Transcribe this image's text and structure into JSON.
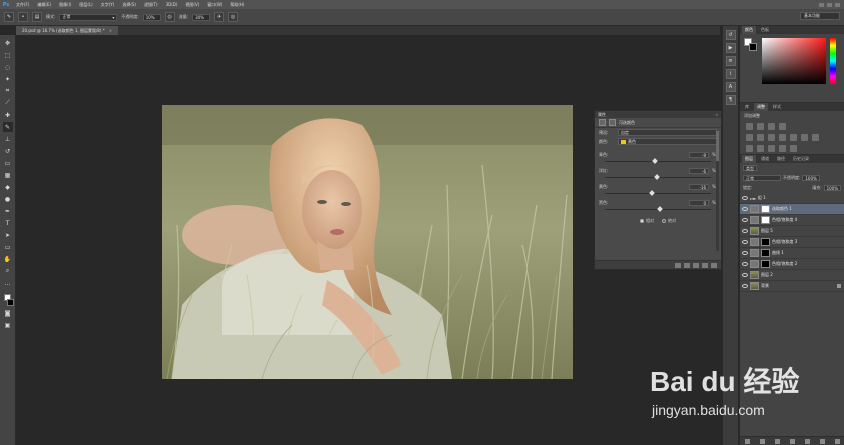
{
  "menubar": {
    "logo": "Ps",
    "items": [
      "文件(F)",
      "编辑(E)",
      "图像(I)",
      "图层(L)",
      "文字(Y)",
      "选择(S)",
      "滤镜(T)",
      "3D(D)",
      "视图(V)",
      "窗口(W)",
      "帮助(H)"
    ]
  },
  "options": {
    "mode_label": "模式:",
    "mode_value": "正常",
    "opacity_label": "不透明度:",
    "opacity_value": "10%",
    "flow_label": "流量:",
    "flow_value": "30%",
    "workspace": "基本功能"
  },
  "document": {
    "tab_title": "20.psd @ 16.7% (选取颜色 1, 图层蒙版/8) *",
    "close": "×"
  },
  "properties": {
    "panel_title": "属性",
    "layer_type": "可选颜色",
    "preset_label": "预设:",
    "preset_value": "自定",
    "colors_label": "颜色:",
    "colors_value": "黄色",
    "color_chip": "#f0c419",
    "sliders": [
      {
        "label": "青色:",
        "value": "-9",
        "unit": "%",
        "level": 0.45
      },
      {
        "label": "洋红:",
        "value": "-6",
        "unit": "%",
        "level": 0.47
      },
      {
        "label": "黄色:",
        "value": "-16",
        "unit": "%",
        "level": 0.42
      },
      {
        "label": "黑色:",
        "value": "0",
        "unit": "%",
        "level": 0.5
      }
    ],
    "radio_relative": "相对",
    "radio_absolute": "绝对"
  },
  "color_panel": {
    "tabs": [
      "颜色",
      "色板"
    ]
  },
  "adjust_panel": {
    "tabs": [
      "库",
      "调整",
      "样式"
    ],
    "label": "添加调整"
  },
  "layers_panel": {
    "tabs": [
      "图层",
      "通道",
      "路径",
      "历史记录"
    ],
    "kind_label": "类型",
    "blend_mode": "正常",
    "opacity_label": "不透明度:",
    "opacity_value": "100%",
    "lock_label": "锁定:",
    "fill_label": "填充:",
    "fill_value": "100%",
    "layers": [
      {
        "name": "组 1",
        "type": "group"
      },
      {
        "name": "选取颜色 1",
        "type": "adj-white",
        "selected": true
      },
      {
        "name": "色相/饱和度 4",
        "type": "adj-white"
      },
      {
        "name": "图层 5",
        "type": "photo"
      },
      {
        "name": "色相/饱和度 3",
        "type": "adj-black"
      },
      {
        "name": "曲线 1",
        "type": "adj-black"
      },
      {
        "name": "色相/饱和度 2",
        "type": "adj-black"
      },
      {
        "name": "图层 2",
        "type": "photo"
      },
      {
        "name": "背景",
        "type": "photo",
        "locked": true
      }
    ]
  },
  "watermark": {
    "brand": "Bai du 经验",
    "url": "jingyan.baidu.com"
  }
}
